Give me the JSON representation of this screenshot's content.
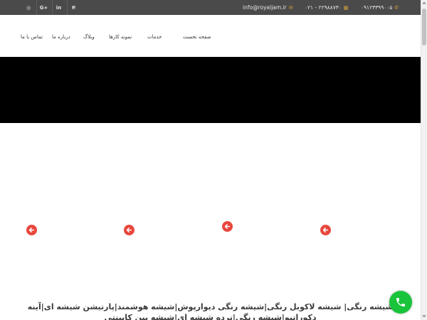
{
  "topbar": {
    "social": {
      "instagram": "◎",
      "google_plus": "G+",
      "linkedin": "in",
      "pinterest": "℗"
    },
    "email": "info@royaljam.ir",
    "phone1": "۰۲۱ - ۲۲۹۸۸۷۳۰",
    "phone2": "۰۹۱۲۳۳۹۹۰۰۵"
  },
  "nav": {
    "items": [
      "تماس با ما",
      "درباره ما",
      "وبلاگ",
      "نمونه کارها",
      "خدمات",
      "صفحه نخست"
    ]
  },
  "tags_text": "شیشه رنگی| شیشه لاکوبل رنگی|شیشه رنگی دیوارپوش|شیشه هوشمند|پارتیشن شیشه ای|آینه دکوراتیو|شیشه رنگی|نرده شیشه ای|شیشه بین کابینتی",
  "colors": {
    "topbar_bg": "#4a4a4a",
    "accent_gold": "#d9a13a",
    "arrow_red": "#e8473d",
    "call_green": "#19c43a",
    "hero_bg": "#000000"
  },
  "icons": {
    "email": "envelope-icon",
    "phone_office": "building-icon",
    "mobile": "phone-icon",
    "arrow": "arrow-left-icon",
    "call": "phone-call-icon"
  }
}
